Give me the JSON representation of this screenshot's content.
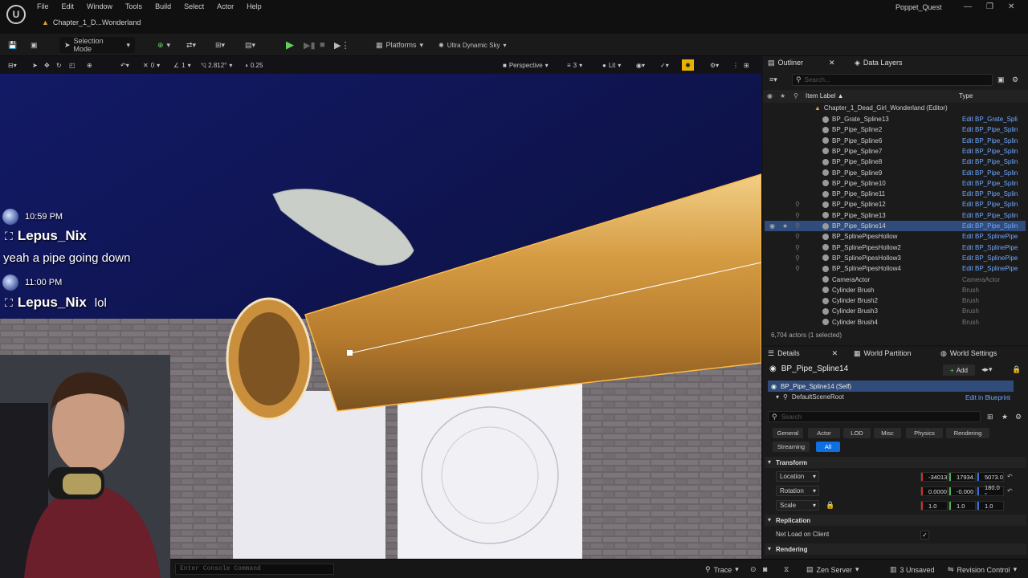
{
  "titlebar": {
    "menu": [
      "File",
      "Edit",
      "Window",
      "Tools",
      "Build",
      "Select",
      "Actor",
      "Help"
    ],
    "doc_tab": "Chapter_1_D...Wonderland",
    "project": "Poppet_Quest",
    "logo": "U"
  },
  "toolbar": {
    "selection_mode": "Selection Mode",
    "platforms": "Platforms",
    "sky": "Ultra Dynamic Sky"
  },
  "viewport_toolbar": {
    "grid_snap": "0",
    "rot_snap": "1",
    "scale_value": "2.812°",
    "camera_speed": "0.25",
    "perspective": "Perspective",
    "view_count": "3",
    "lit": "Lit"
  },
  "chat": {
    "msg1_time": "10:59 PM",
    "msg1_user": "Lepus_Nix",
    "msg1_text": "yeah a pipe going down",
    "msg2_time": "11:00 PM",
    "msg2_user": "Lepus_Nix",
    "msg2_text": "lol"
  },
  "console": {
    "placeholder": "Enter Console Command"
  },
  "statusbar": {
    "trace": "Trace",
    "zen": "Zen Server",
    "unsaved": "3 Unsaved",
    "revision": "Revision Control"
  },
  "outliner": {
    "tab": "Outliner",
    "tab2": "Data Layers",
    "search_placeholder": "Search...",
    "col_label": "Item Label ▲",
    "col_type": "Type",
    "root": "Chapter_1_Dead_Girl_Wonderland (Editor)",
    "rows": [
      {
        "name": "BP_Grate_Spline13",
        "type": "Edit BP_Grate_Spli"
      },
      {
        "name": "BP_Pipe_Spline2",
        "type": "Edit BP_Pipe_Splin"
      },
      {
        "name": "BP_Pipe_Spline6",
        "type": "Edit BP_Pipe_Splin"
      },
      {
        "name": "BP_Pipe_Spline7",
        "type": "Edit BP_Pipe_Splin"
      },
      {
        "name": "BP_Pipe_Spline8",
        "type": "Edit BP_Pipe_Splin"
      },
      {
        "name": "BP_Pipe_Spline9",
        "type": "Edit BP_Pipe_Splin"
      },
      {
        "name": "BP_Pipe_Spline10",
        "type": "Edit BP_Pipe_Splin"
      },
      {
        "name": "BP_Pipe_Spline11",
        "type": "Edit BP_Pipe_Splin"
      },
      {
        "name": "BP_Pipe_Spline12",
        "type": "Edit BP_Pipe_Splin"
      },
      {
        "name": "BP_Pipe_Spline13",
        "type": "Edit BP_Pipe_Splin"
      },
      {
        "name": "BP_Pipe_Spline14",
        "type": "Edit BP_Pipe_Splin"
      },
      {
        "name": "BP_SplinePipesHollow",
        "type": "Edit BP_SplinePipe"
      },
      {
        "name": "BP_SplinePipesHollow2",
        "type": "Edit BP_SplinePipe"
      },
      {
        "name": "BP_SplinePipesHollow3",
        "type": "Edit BP_SplinePipe"
      },
      {
        "name": "BP_SplinePipesHollow4",
        "type": "Edit BP_SplinePipe"
      },
      {
        "name": "CameraActor",
        "type": "CameraActor"
      },
      {
        "name": "Cylinder Brush",
        "type": "Brush"
      },
      {
        "name": "Cylinder Brush2",
        "type": "Brush"
      },
      {
        "name": "Cylinder Brush3",
        "type": "Brush"
      },
      {
        "name": "Cylinder Brush4",
        "type": "Brush"
      }
    ],
    "footer": "6,704 actors (1 selected)"
  },
  "details": {
    "tab": "Details",
    "tab2": "World Partition",
    "tab3": "World Settings",
    "actor_name": "BP_Pipe_Spline14",
    "add": "Add",
    "self_row": "BP_Pipe_Spline14 (Self)",
    "root_comp": "DefaultSceneRoot",
    "edit_bp": "Edit in Blueprint",
    "search_placeholder": "Search",
    "filters": [
      "General",
      "Actor",
      "LOD",
      "Misc",
      "Physics",
      "Rendering"
    ],
    "filters2": [
      "Streaming",
      "All"
    ],
    "transform": "Transform",
    "location": "Location",
    "rotation": "Rotation",
    "scale": "Scale",
    "loc": [
      "-34013",
      "17934.",
      "5073.0"
    ],
    "rot": [
      "0.0000",
      "-0.000",
      "180.0 °"
    ],
    "scl": [
      "1.0",
      "1.0",
      "1.0"
    ],
    "replication": "Replication",
    "net_load": "Net Load on Client",
    "rendering": "Rendering"
  }
}
